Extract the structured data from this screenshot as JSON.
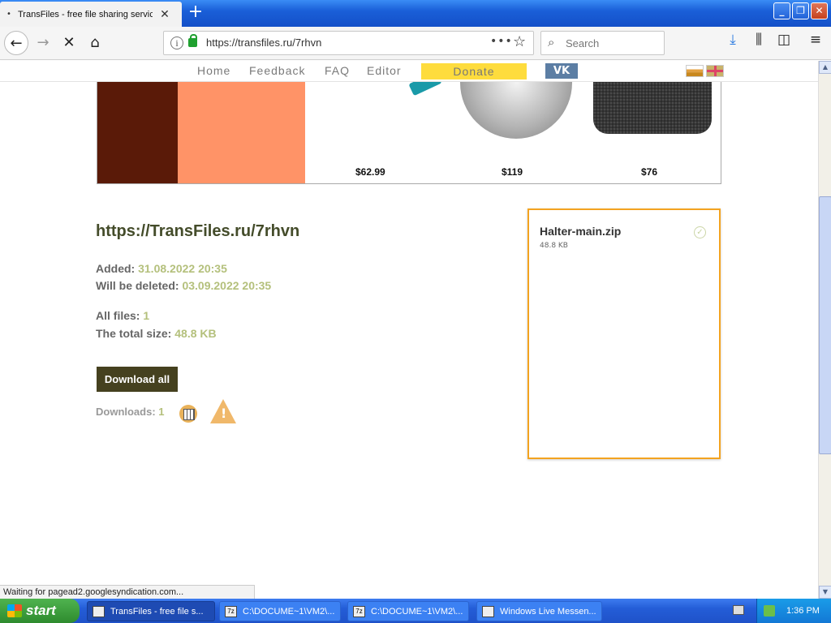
{
  "browser": {
    "tab_title": "TransFiles - free file sharing servic",
    "url": "https://transfiles.ru/7rhvn",
    "search_placeholder": "Search",
    "status_text": "Waiting for pagead2.googlesyndication.com..."
  },
  "site_nav": {
    "items": [
      "Home",
      "Feedback",
      "FAQ",
      "Editor"
    ],
    "donate_label": "Donate",
    "vk_label": "VK"
  },
  "ad": {
    "prices": [
      "$62.99",
      "$119",
      "$76"
    ]
  },
  "file_page": {
    "link_title": "https://TransFiles.ru/7rhvn",
    "added_label": "Added:",
    "added_value": "31.08.2022 20:35",
    "deleted_label": "Will be deleted:",
    "deleted_value": "03.09.2022 20:35",
    "all_files_label": "All files:",
    "all_files_value": "1",
    "total_size_label": "The total size:",
    "total_size_value": "48.8 KB",
    "download_all_label": "Download all",
    "downloads_label": "Downloads:",
    "downloads_value": "1"
  },
  "file_list": [
    {
      "name": "Halter-main.zip",
      "size": "48.8 KB"
    }
  ],
  "taskbar": {
    "start_label": "start",
    "tasks": [
      "TransFiles - free file s...",
      "C:\\DOCUME~1\\VM2\\...",
      "C:\\DOCUME~1\\VM2\\...",
      "Windows Live Messen..."
    ],
    "clock": "1:36 PM"
  },
  "colors": {
    "accent_olive": "#45411f",
    "value_green": "#b4c07c",
    "donate_yellow": "#fedc3d",
    "vk_blue": "#5c7ea4",
    "file_box_border": "#f3a320"
  }
}
